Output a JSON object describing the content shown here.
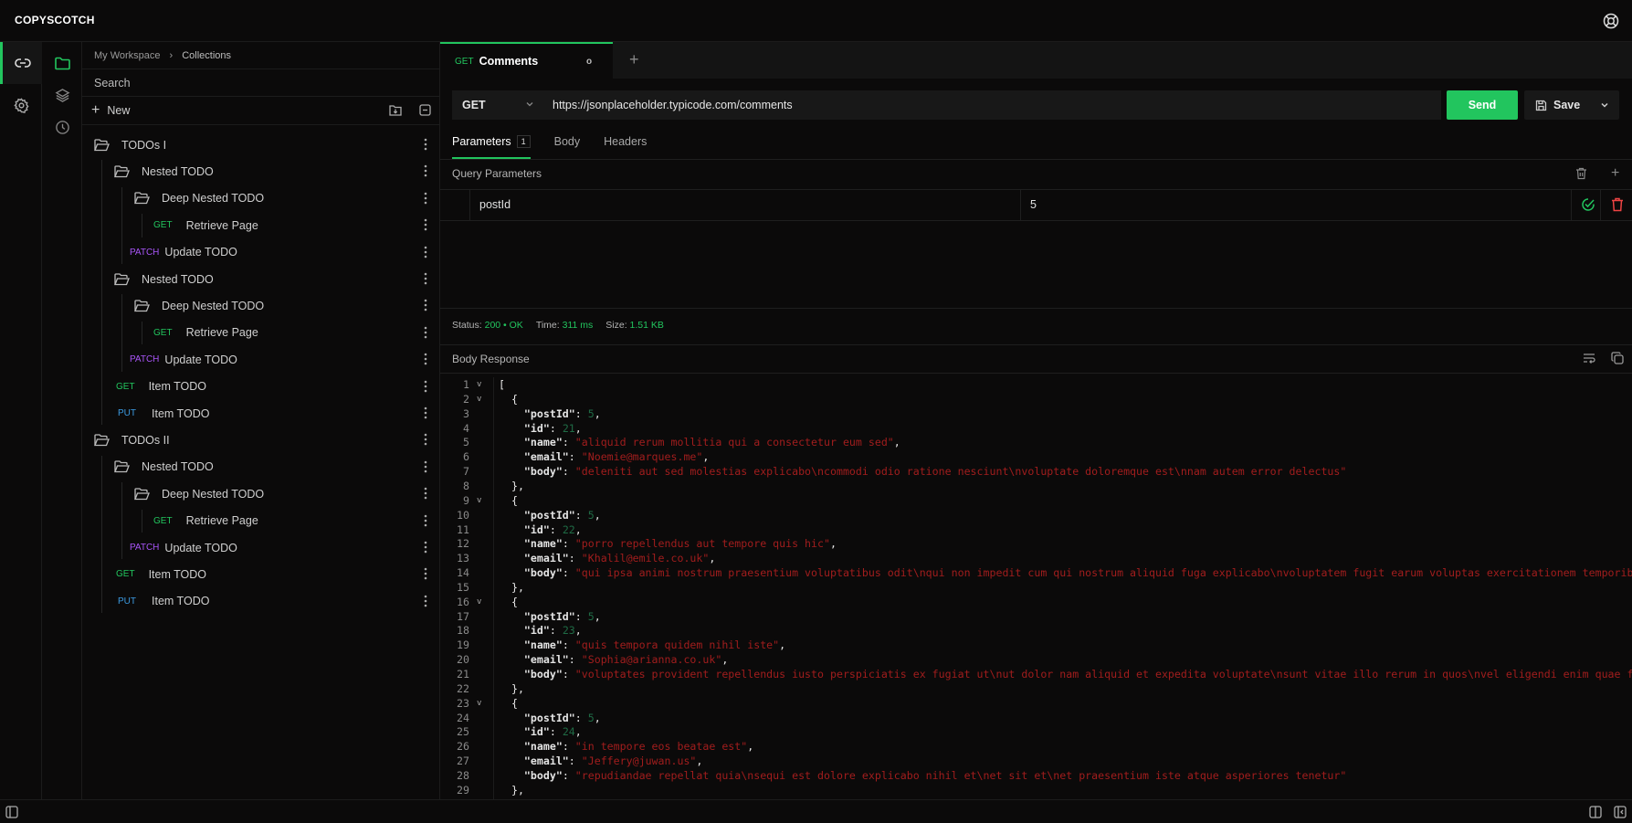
{
  "app": {
    "title": "COPYSCOTCH",
    "help_icon": "lifebuoy-icon"
  },
  "colors": {
    "accent": "#22c55e",
    "get": "#22c55e",
    "patch": "#a855f7",
    "put": "#3b9ae1",
    "string": "#a11d1d",
    "number": "#1f6b45",
    "delete": "#ef4444"
  },
  "rail": {
    "items": [
      {
        "name": "rest",
        "icon": "link-icon",
        "active": true
      },
      {
        "name": "settings",
        "icon": "gear-icon"
      }
    ]
  },
  "rail2": {
    "items": [
      {
        "name": "collections",
        "icon": "folder-icon",
        "active": true
      },
      {
        "name": "environments",
        "icon": "layers-icon"
      },
      {
        "name": "history",
        "icon": "clock-icon"
      }
    ]
  },
  "sidebar": {
    "breadcrumb": [
      "My Workspace",
      "Collections"
    ],
    "search_placeholder": "Search",
    "new_label": "New",
    "tree": [
      {
        "type": "folder",
        "label": "TODOs I",
        "depth": 0
      },
      {
        "type": "folder",
        "label": "Nested TODO",
        "depth": 1
      },
      {
        "type": "folder",
        "label": "Deep Nested TODO",
        "depth": 2
      },
      {
        "type": "request",
        "method": "GET",
        "label": "Retrieve Page",
        "depth": 3
      },
      {
        "type": "request",
        "method": "PATCH",
        "label": "Update TODO",
        "depth": 2
      },
      {
        "type": "folder",
        "label": "Nested TODO",
        "depth": 1
      },
      {
        "type": "folder",
        "label": "Deep Nested TODO",
        "depth": 2
      },
      {
        "type": "request",
        "method": "GET",
        "label": "Retrieve Page",
        "depth": 3
      },
      {
        "type": "request",
        "method": "PATCH",
        "label": "Update TODO",
        "depth": 2
      },
      {
        "type": "request",
        "method": "GET",
        "label": "Item TODO",
        "depth": 1
      },
      {
        "type": "request",
        "method": "PUT",
        "label": "Item TODO",
        "depth": 1
      },
      {
        "type": "folder",
        "label": "TODOs II",
        "depth": 0
      },
      {
        "type": "folder",
        "label": "Nested TODO",
        "depth": 1
      },
      {
        "type": "folder",
        "label": "Deep Nested TODO",
        "depth": 2
      },
      {
        "type": "request",
        "method": "GET",
        "label": "Retrieve Page",
        "depth": 3
      },
      {
        "type": "request",
        "method": "PATCH",
        "label": "Update TODO",
        "depth": 2
      },
      {
        "type": "request",
        "method": "GET",
        "label": "Item TODO",
        "depth": 1
      },
      {
        "type": "request",
        "method": "PUT",
        "label": "Item TODO",
        "depth": 1
      }
    ]
  },
  "tabs": [
    {
      "method": "GET",
      "label": "Comments",
      "indicator": "o"
    }
  ],
  "request": {
    "method": "GET",
    "url": "https://jsonplaceholder.typicode.com/comments",
    "send_label": "Send",
    "save_label": "Save"
  },
  "param_tabs": [
    {
      "label": "Parameters",
      "badge": "1",
      "active": true
    },
    {
      "label": "Body"
    },
    {
      "label": "Headers"
    }
  ],
  "query": {
    "title": "Query Parameters",
    "rows": [
      {
        "key": "postId",
        "value": "5",
        "enabled": true
      }
    ]
  },
  "response": {
    "status_label": "Status:",
    "status": "200 • OK",
    "time_label": "Time:",
    "time": "311 ms",
    "size_label": "Size:",
    "size": "1.51 KB",
    "body_title": "Body Response",
    "items": [
      {
        "postId": 5,
        "id": 21,
        "name": "aliquid rerum mollitia qui a consectetur eum sed",
        "email": "Noemie@marques.me",
        "body": "deleniti aut sed molestias explicabo\\ncommodi odio ratione nesciunt\\nvoluptate doloremque est\\nnam autem error delectus"
      },
      {
        "postId": 5,
        "id": 22,
        "name": "porro repellendus aut tempore quis hic",
        "email": "Khalil@emile.co.uk",
        "body": "qui ipsa animi nostrum praesentium voluptatibus odit\\nqui non impedit cum qui nostrum aliquid fuga explicabo\\nvoluptatem fugit earum voluptas exercitationem temporibus dign"
      },
      {
        "postId": 5,
        "id": 23,
        "name": "quis tempora quidem nihil iste",
        "email": "Sophia@arianna.co.uk",
        "body": "voluptates provident repellendus iusto perspiciatis ex fugiat ut\\nut dolor nam aliquid et expedita voluptate\\nsunt vitae illo rerum in quos\\nvel eligendi enim quae fugiat e"
      },
      {
        "postId": 5,
        "id": 24,
        "name": "in tempore eos beatae est",
        "email": "Jeffery@juwan.us",
        "body": "repudiandae repellat quia\\nsequi est dolore explicabo nihil et\\net sit et\\net praesentium iste atque asperiores tenetur"
      }
    ]
  }
}
